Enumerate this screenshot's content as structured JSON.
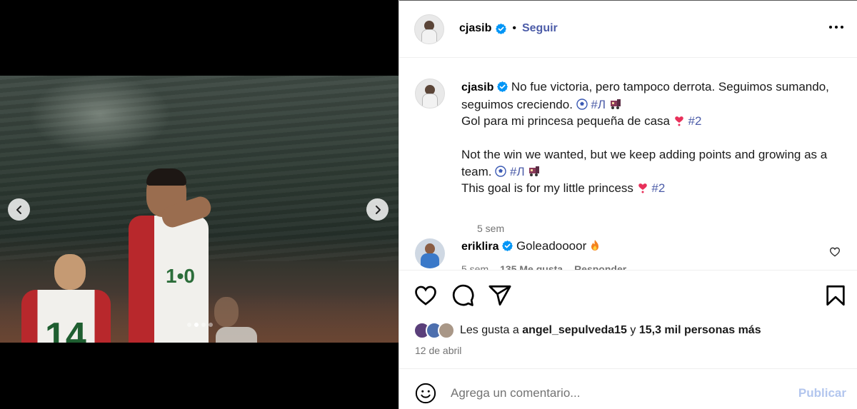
{
  "post": {
    "author": "cjasib",
    "follow_label": "Seguir",
    "separator": "•"
  },
  "caption": {
    "username": "cjasib",
    "line1": "No fue victoria, pero tampoco derrota. Seguimos sumando, seguimos creciendo.",
    "hashtag_club": "#Л",
    "line2": "Gol para mi princesa pequeña de casa",
    "hashtag_number": "#2",
    "line3": "Not the win we wanted, but we keep adding points and growing as a team.",
    "line4": "This goal is for my little princess",
    "time": "5 sem"
  },
  "reply": {
    "username": "eriklira",
    "text": "Goleadoooor",
    "time": "5 sem",
    "likes": "135 Me gusta",
    "reply_label": "Responder"
  },
  "likes": {
    "prefix": "Les gusta a",
    "user": "angel_sepulveda15",
    "middle": "y",
    "count": "15,3 mil personas más"
  },
  "date": "12 de abril",
  "composer": {
    "placeholder": "Agrega un comentario...",
    "publish_label": "Publicar"
  },
  "carousel": {
    "total_slides": 4,
    "active_slide": 2
  },
  "icons": {
    "verified": "verified-badge-icon",
    "more": "more-options-icon",
    "like": "heart-icon",
    "comment": "comment-bubble-icon",
    "share": "paper-plane-icon",
    "save": "bookmark-icon",
    "emoji": "smiley-icon",
    "prev": "chevron-left-icon",
    "next": "chevron-right-icon"
  },
  "colors": {
    "link_blue": "#4c5ca8",
    "verified_blue": "#0095f6",
    "publish_disabled": "#b3c6ee",
    "muted_text": "#737373",
    "heart_pink": "#e8305a"
  }
}
